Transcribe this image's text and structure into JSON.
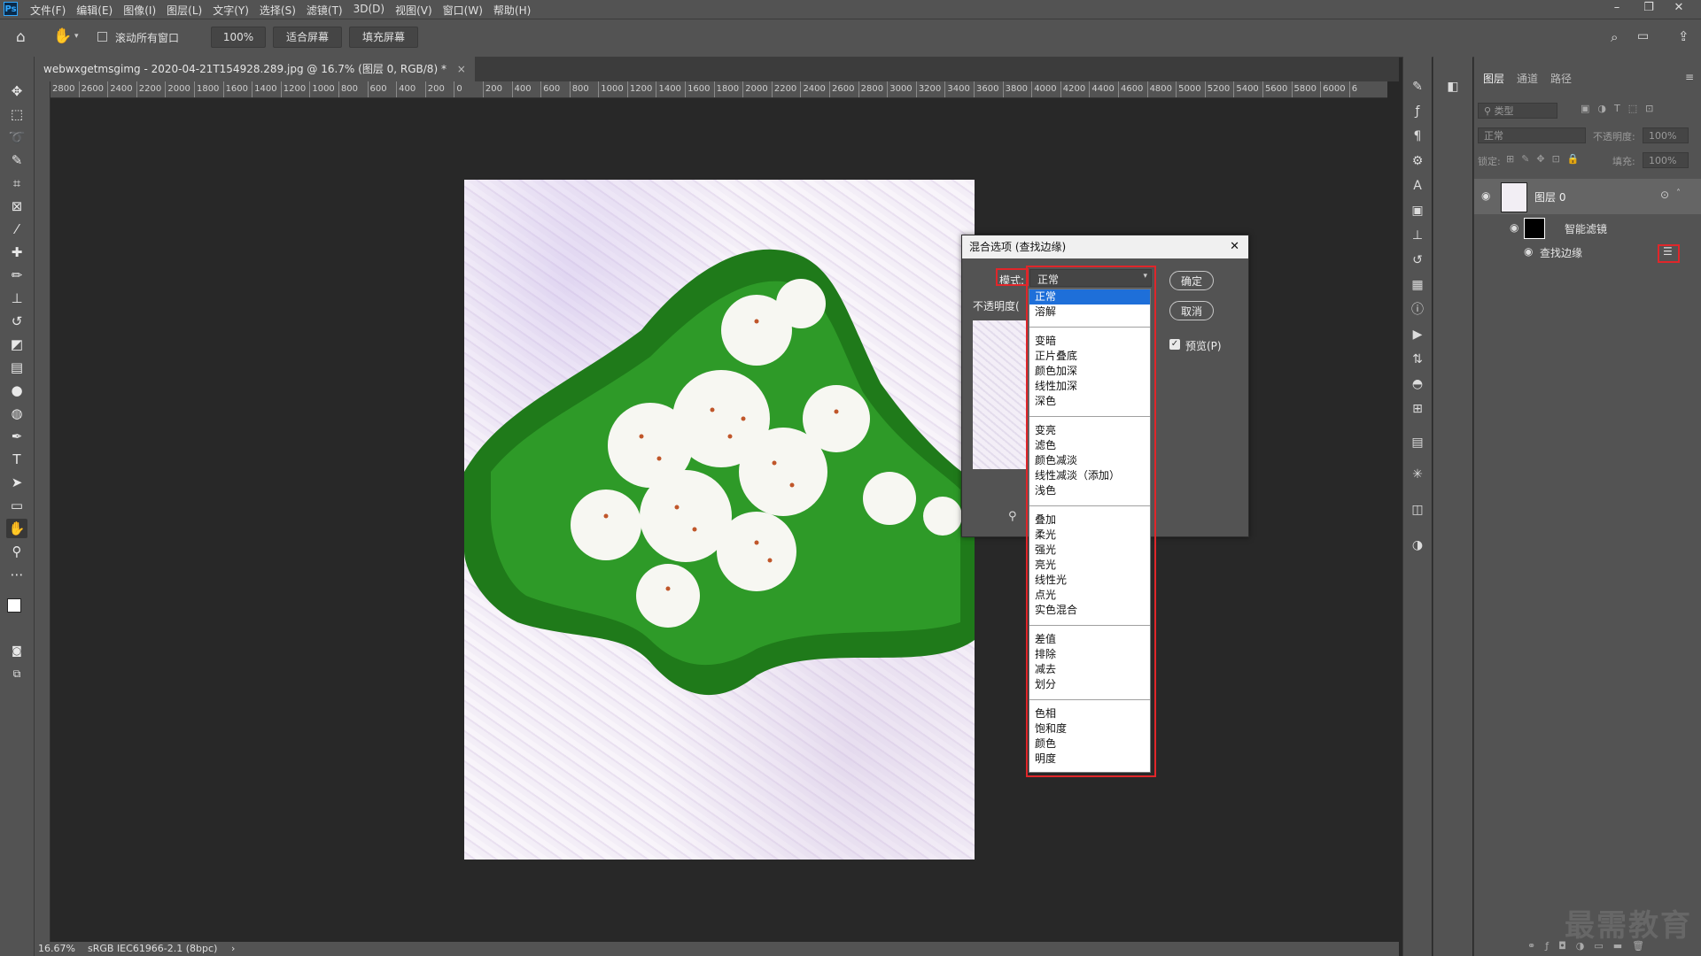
{
  "app": {
    "logo": "Ps"
  },
  "menubar": {
    "items": [
      "文件(F)",
      "编辑(E)",
      "图像(I)",
      "图层(L)",
      "文字(Y)",
      "选择(S)",
      "滤镜(T)",
      "3D(D)",
      "视图(V)",
      "窗口(W)",
      "帮助(H)"
    ]
  },
  "window_controls": {
    "minimize": "–",
    "restore": "❐",
    "close": "✕"
  },
  "optionsbar": {
    "scroll_all": "滚动所有窗口",
    "zoom": "100%",
    "fit_screen": "适合屏幕",
    "fill_screen": "填充屏幕"
  },
  "document": {
    "tab_title": "webwxgetmsgimg - 2020-04-21T154928.289.jpg @ 16.7% (图层 0, RGB/8) *",
    "close": "×"
  },
  "ruler": {
    "marks": [
      "2800",
      "2600",
      "2400",
      "2200",
      "2000",
      "1800",
      "1600",
      "1400",
      "1200",
      "1000",
      "800",
      "600",
      "400",
      "200",
      "0",
      "200",
      "400",
      "600",
      "800",
      "1000",
      "1200",
      "1400",
      "1600",
      "1800",
      "2000",
      "2200",
      "2400",
      "2600",
      "2800",
      "3000",
      "3200",
      "3400",
      "3600",
      "3800",
      "4000",
      "4200",
      "4400",
      "4600",
      "4800",
      "5000",
      "5200",
      "5400",
      "5600",
      "5800",
      "6000",
      "6"
    ]
  },
  "status": {
    "zoom": "16.67%",
    "profile": "sRGB IEC61966-2.1 (8bpc)",
    "arrow": "›"
  },
  "layers_panel": {
    "tabs": [
      "图层",
      "通道",
      "路径"
    ],
    "filter_placeholder": "类型",
    "blend_mode": "正常",
    "opacity_label": "不透明度:",
    "opacity_value": "100%",
    "lock_label": "锁定:",
    "fill_label": "填充:",
    "fill_value": "100%",
    "layer_name": "图层 0",
    "smart_filter": "智能滤镜",
    "filter_name": "查找边缘"
  },
  "dialog": {
    "title": "混合选项 (查找边缘)",
    "mode_label": "模式:",
    "mode_value": "正常",
    "opacity_label": "不透明度(",
    "ok": "确定",
    "cancel": "取消",
    "preview": "预览(P)",
    "close": "✕"
  },
  "dropdown": {
    "groups": [
      [
        "正常",
        "溶解"
      ],
      [
        "变暗",
        "正片叠底",
        "颜色加深",
        "线性加深",
        "深色"
      ],
      [
        "变亮",
        "滤色",
        "颜色减淡",
        "线性减淡（添加）",
        "浅色"
      ],
      [
        "叠加",
        "柔光",
        "强光",
        "亮光",
        "线性光",
        "点光",
        "实色混合"
      ],
      [
        "差值",
        "排除",
        "减去",
        "划分"
      ],
      [
        "色相",
        "饱和度",
        "颜色",
        "明度"
      ]
    ],
    "selected": "正常"
  },
  "watermark": "最需教育",
  "colors": {
    "highlight": "#e0262a",
    "selection": "#1e6fd9"
  }
}
